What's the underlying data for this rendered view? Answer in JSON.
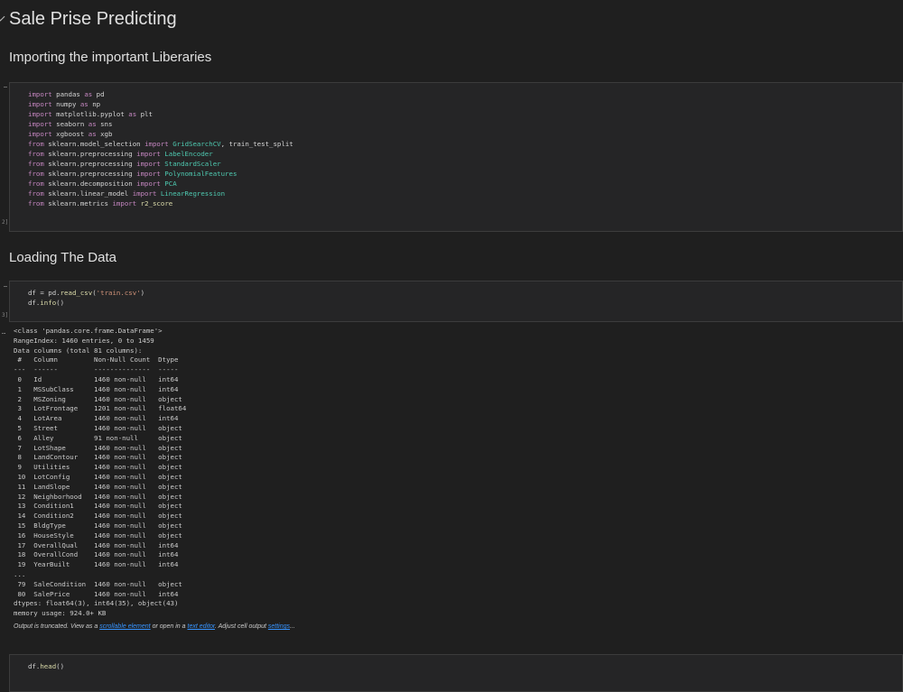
{
  "notebook": {
    "title": "Sale Prise Predicting",
    "section1": "Importing the important Liberaries",
    "section2": "Loading The Data"
  },
  "cell1": {
    "lines": [
      [
        [
          "kw",
          "import"
        ],
        [
          "mod",
          " pandas "
        ],
        [
          "kw",
          "as"
        ],
        [
          "mod",
          " pd"
        ]
      ],
      [
        [
          "kw",
          "import"
        ],
        [
          "mod",
          " numpy "
        ],
        [
          "kw",
          "as"
        ],
        [
          "mod",
          " np"
        ]
      ],
      [
        [
          "kw",
          "import"
        ],
        [
          "mod",
          " matplotlib.pyplot "
        ],
        [
          "kw",
          "as"
        ],
        [
          "mod",
          " plt"
        ]
      ],
      [
        [
          "kw",
          "import"
        ],
        [
          "mod",
          " seaborn "
        ],
        [
          "kw",
          "as"
        ],
        [
          "mod",
          " sns"
        ]
      ],
      [
        [
          "kw",
          "import"
        ],
        [
          "mod",
          " xgboost "
        ],
        [
          "kw",
          "as"
        ],
        [
          "mod",
          " xgb"
        ]
      ],
      [
        [
          "kw",
          "from"
        ],
        [
          "mod",
          " sklearn.model_selection "
        ],
        [
          "kw",
          "import"
        ],
        [
          "cls",
          " GridSearchCV"
        ],
        [
          "mod",
          ", train_test_split"
        ]
      ],
      [
        [
          "kw",
          "from"
        ],
        [
          "mod",
          " sklearn.preprocessing "
        ],
        [
          "kw",
          "import"
        ],
        [
          "cls",
          " LabelEncoder"
        ]
      ],
      [
        [
          "kw",
          "from"
        ],
        [
          "mod",
          " sklearn.preprocessing "
        ],
        [
          "kw",
          "import"
        ],
        [
          "cls",
          " StandardScaler"
        ]
      ],
      [
        [
          "kw",
          "from"
        ],
        [
          "mod",
          " sklearn.preprocessing "
        ],
        [
          "kw",
          "import"
        ],
        [
          "cls",
          " PolynomialFeatures"
        ]
      ],
      [
        [
          "kw",
          "from"
        ],
        [
          "mod",
          " sklearn.decomposition "
        ],
        [
          "kw",
          "import"
        ],
        [
          "cls",
          " PCA"
        ]
      ],
      [
        [
          "kw",
          "from"
        ],
        [
          "mod",
          " sklearn.linear_model "
        ],
        [
          "kw",
          "import"
        ],
        [
          "cls",
          " LinearRegression"
        ]
      ],
      [
        [
          "kw",
          "from"
        ],
        [
          "mod",
          " sklearn.metrics "
        ],
        [
          "kw",
          "import"
        ],
        [
          "fn",
          " r2_score"
        ]
      ]
    ],
    "exec_count": "2]"
  },
  "cell2": {
    "lines": [
      [
        [
          "mod",
          "df = pd."
        ],
        [
          "fn",
          "read_csv"
        ],
        [
          "mod",
          "("
        ],
        [
          "str",
          "'train.csv'"
        ],
        [
          "mod",
          ")"
        ]
      ],
      [
        [
          "mod",
          "df."
        ],
        [
          "fn",
          "info"
        ],
        [
          "mod",
          "()"
        ]
      ]
    ],
    "exec_count": "3]"
  },
  "output": {
    "marker": "…",
    "lines": [
      "<class 'pandas.core.frame.DataFrame'>",
      "RangeIndex: 1460 entries, 0 to 1459",
      "Data columns (total 81 columns):",
      " #   Column         Non-Null Count  Dtype  ",
      "---  ------         --------------  -----  ",
      " 0   Id             1460 non-null   int64  ",
      " 1   MSSubClass     1460 non-null   int64  ",
      " 2   MSZoning       1460 non-null   object ",
      " 3   LotFrontage    1201 non-null   float64",
      " 4   LotArea        1460 non-null   int64  ",
      " 5   Street         1460 non-null   object ",
      " 6   Alley          91 non-null     object ",
      " 7   LotShape       1460 non-null   object ",
      " 8   LandContour    1460 non-null   object ",
      " 9   Utilities      1460 non-null   object ",
      " 10  LotConfig      1460 non-null   object ",
      " 11  LandSlope      1460 non-null   object ",
      " 12  Neighborhood   1460 non-null   object ",
      " 13  Condition1     1460 non-null   object ",
      " 14  Condition2     1460 non-null   object ",
      " 15  BldgType       1460 non-null   object ",
      " 16  HouseStyle     1460 non-null   object ",
      " 17  OverallQual    1460 non-null   int64  ",
      " 18  OverallCond    1460 non-null   int64  ",
      " 19  YearBuilt      1460 non-null   int64  ",
      "...",
      " 79  SaleCondition  1460 non-null   object ",
      " 80  SalePrice      1460 non-null   int64  ",
      "dtypes: float64(3), int64(35), object(43)",
      "memory usage: 924.0+ KB"
    ],
    "truncated": {
      "prefix": "Output is truncated. View as a ",
      "link1": "scrollable element",
      "mid1": " or open in a ",
      "link2": "text editor",
      "mid2": ". Adjust cell output ",
      "link3": "settings",
      "suffix": "..."
    }
  },
  "cell3": {
    "lines": [
      [
        [
          "mod",
          "df."
        ],
        [
          "fn",
          "head"
        ],
        [
          "mod",
          "()"
        ]
      ]
    ]
  }
}
